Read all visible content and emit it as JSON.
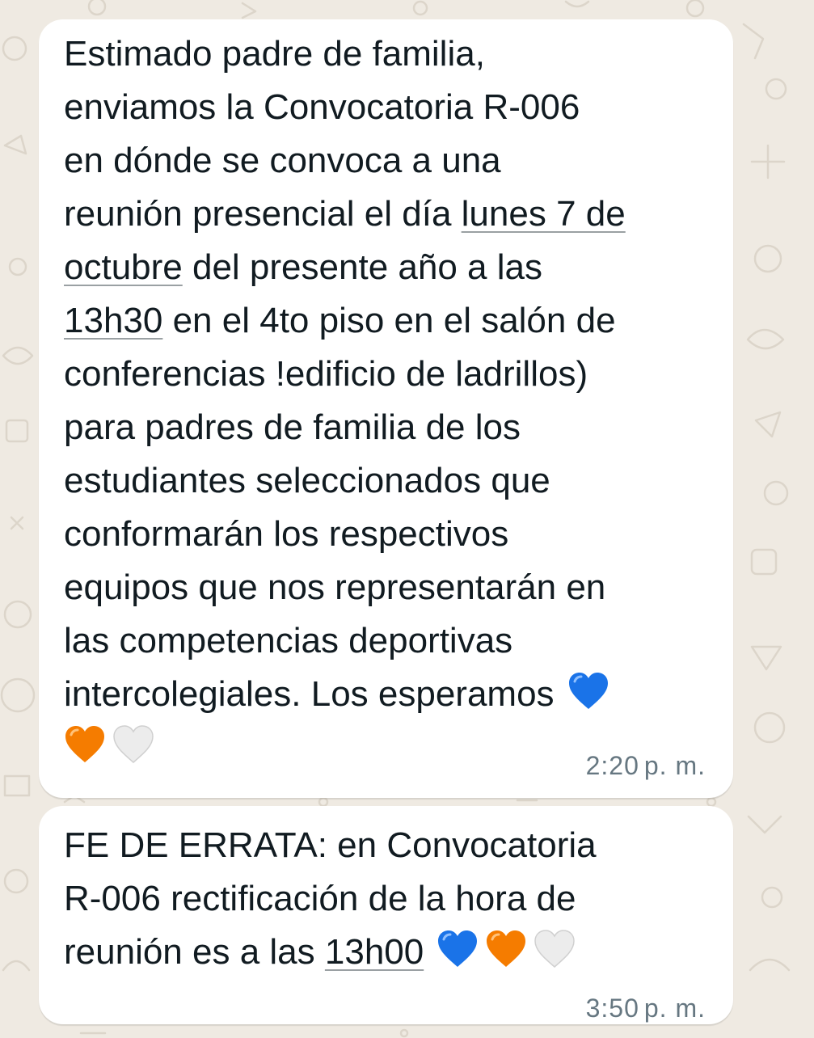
{
  "messages": [
    {
      "lines": [
        {
          "text": "Estimado padre de familia,"
        },
        {
          "text": "enviamos la Convocatoria R-006"
        },
        {
          "text": "en dónde se convoca a una"
        },
        {
          "pre": "reunión presencial el día ",
          "link": "lunes 7 de"
        },
        {
          "link": "octubre",
          "post": " del presente año a las"
        },
        {
          "link": "13h30",
          "post": " en el 4to piso en el salón de"
        },
        {
          "text": "conferencias !edificio de ladrillos)"
        },
        {
          "text": "para padres de familia de los"
        },
        {
          "text": "estudiantes seleccionados que"
        },
        {
          "text": "conformarán los respectivos"
        },
        {
          "text": "equipos que nos representarán en"
        },
        {
          "text": "las competencias deportivas"
        },
        {
          "text": "intercolegiales. Los esperamos"
        }
      ],
      "emojis": [
        "blue-heart",
        "orange-heart",
        "white-heart"
      ],
      "time": "2:20",
      "ampm": "p. m."
    },
    {
      "lines": [
        {
          "text": "FE DE ERRATA: en Convocatoria"
        },
        {
          "text": "R-006 rectificación de la hora de"
        },
        {
          "pre": "reunión es a las ",
          "link": "13h00"
        }
      ],
      "emojis": [
        "blue-heart",
        "orange-heart",
        "white-heart"
      ],
      "time": "3:50",
      "ampm": "p. m."
    }
  ],
  "colors": {
    "chat_background": "#efeae2",
    "bubble": "#ffffff",
    "text": "#111b21",
    "timestamp": "#667781",
    "heart_blue": "#1a73e8",
    "heart_orange": "#f57c00",
    "heart_white": "#e6e6e6"
  }
}
